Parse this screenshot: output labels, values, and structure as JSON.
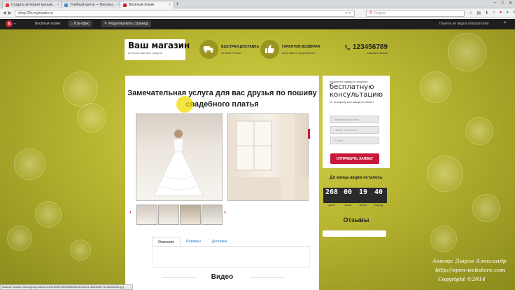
{
  "browser": {
    "tabs": [
      {
        "label": "Создать интернет магази...",
        "color": "#d33"
      },
      {
        "label": "Учебный центр — Веселы...",
        "color": "#4a86c6"
      },
      {
        "label": "Весёлый Хомяк",
        "color": "#c8202f"
      }
    ],
    "new_tab": "+",
    "url": "shop-26s.myinsales.ru",
    "search_placeholder": "Яндекс"
  },
  "sitebar": {
    "logo": "S",
    "site_name": "Весёлый Хомяк",
    "back_office": "Бэк-офис",
    "edit_page": "Редактировать страницу",
    "panel_hidden": "Панель не видна покупателям",
    "close": "×"
  },
  "header": {
    "brand_title": "Ваш магазин",
    "brand_sub": "интернет-магазин товаров",
    "delivery_title": "БЫСТРАЯ ДОСТАВКА",
    "delivery_sub": "по всей России",
    "guarantee_title": "ГАРАНТИЯ ВОЗВРАТА",
    "guarantee_sub": "если вам не понравиться",
    "phone": "123456789",
    "callback": "заказать звонок"
  },
  "main": {
    "headline_1": "Замечательная услуга для вас друзья по пошиву",
    "headline_2": "свадебного платья",
    "tabs": [
      "Описание",
      "Размеры",
      "Доставка"
    ],
    "video_title": "Видео"
  },
  "form": {
    "intro": "Заполните заявку и получите",
    "big_1": "бесплатную",
    "big_2": "консультацию",
    "note": "по телефону или выезд на объект",
    "name_placeholder": "Введите ваше имя",
    "phone_placeholder": "Номер телефона",
    "email_placeholder": "E-mail",
    "submit": "ОТПРАВИТЬ ЗАЯВКУ"
  },
  "timer": {
    "title": "До конца акции осталось",
    "values": [
      "268",
      "00",
      "19",
      "40"
    ],
    "labels": [
      "дней",
      "часов",
      "минут",
      "секунд"
    ]
  },
  "reviews": {
    "title": "Отзывы"
  },
  "statusbar": "static12.insales.ru/images/products/1/2446/39169206/8255331c9a221 3a0bbdb27110082043c.jpg",
  "watermark": {
    "line1": "Автор: Дырза Александр",
    "line2": "http://open-webstore.com",
    "line3": "Copyright ©2014"
  },
  "colors": {
    "accent": "#c8173a",
    "olive": "#b9b631"
  }
}
